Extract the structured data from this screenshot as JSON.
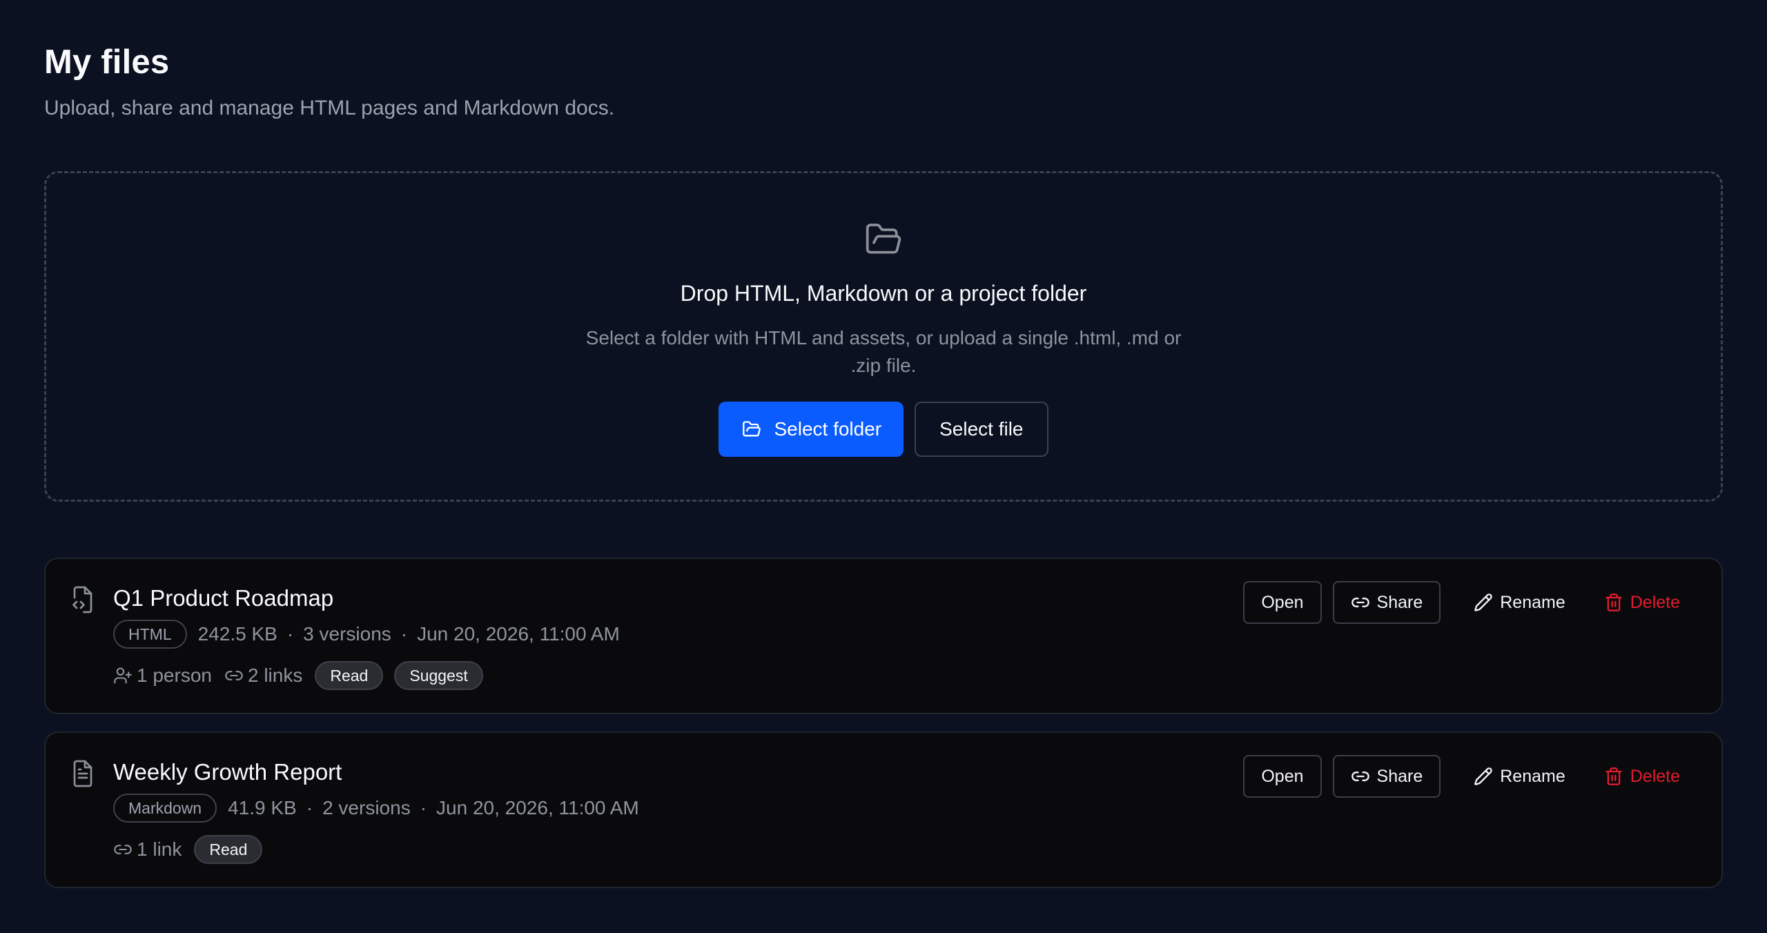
{
  "header": {
    "title": "My files",
    "subtitle": "Upload, share and manage HTML pages and Markdown docs."
  },
  "dropzone": {
    "icon": "folder-open-icon",
    "title": "Drop HTML, Markdown or a project folder",
    "description": "Select a folder with HTML and assets, or upload a single .html, .md or .zip file.",
    "select_folder_label": "Select folder",
    "select_file_label": "Select file"
  },
  "colors": {
    "background": "#0b1120",
    "primary": "#0a5cff",
    "danger": "#e11d2e",
    "muted": "#8e949e"
  },
  "files": [
    {
      "name": "Q1 Product Roadmap",
      "icon": "file-code-icon",
      "type": "HTML",
      "size": "242.5 KB",
      "versions": "3 versions",
      "date": "Jun 20, 2026, 11:00 AM",
      "people": "1 person",
      "links": "2 links",
      "permissions": [
        "Read",
        "Suggest"
      ],
      "actions": {
        "open": "Open",
        "share": "Share",
        "rename": "Rename",
        "delete": "Delete"
      }
    },
    {
      "name": "Weekly Growth Report",
      "icon": "file-text-icon",
      "type": "Markdown",
      "size": "41.9 KB",
      "versions": "2 versions",
      "date": "Jun 20, 2026, 11:00 AM",
      "links": "1 link",
      "permissions": [
        "Read"
      ],
      "actions": {
        "open": "Open",
        "share": "Share",
        "rename": "Rename",
        "delete": "Delete"
      }
    }
  ]
}
